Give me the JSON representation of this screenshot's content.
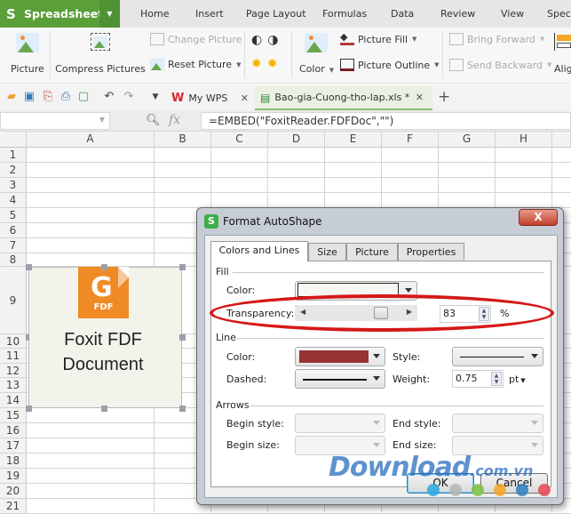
{
  "menubar": {
    "app_name": "Spreadsheets",
    "app_logo": "S",
    "items": [
      "Home",
      "Insert",
      "Page Layout",
      "Formulas",
      "Data",
      "Review",
      "View",
      "Spec"
    ]
  },
  "ribbon": {
    "picture": "Picture",
    "compress_pictures": "Compress Pictures",
    "change_picture": "Change Picture",
    "reset_picture": "Reset Picture",
    "color": "Color",
    "picture_fill": "Picture Fill",
    "picture_outline": "Picture Outline",
    "bring_forward": "Bring Forward",
    "send_backward": "Send Backward",
    "align": "Alig"
  },
  "tabs": [
    {
      "label": "My WPS",
      "icon": "wps-logo-icon"
    },
    {
      "label": "Bao-gia-Cuong-tho-lap.xls *",
      "icon": "xls-file-icon",
      "active": true
    }
  ],
  "formula_bar": {
    "name_box": "",
    "fx": "fx",
    "formula": "=EMBED(\"FoxitReader.FDFDoc\",\"\")"
  },
  "grid": {
    "columns": [
      "A",
      "B",
      "C",
      "D",
      "E",
      "F",
      "G",
      "H"
    ],
    "rows": [
      "1",
      "2",
      "3",
      "4",
      "5",
      "6",
      "7",
      "8",
      "9",
      "10",
      "11",
      "12",
      "13",
      "14",
      "15",
      "16",
      "17",
      "18",
      "19",
      "20",
      "21"
    ]
  },
  "embedded_object": {
    "icon_label": "FDF",
    "caption_line1": "Foxit FDF",
    "caption_line2": "Document",
    "accent": "#f08a24"
  },
  "dialog": {
    "title": "Format AutoShape",
    "close": "X",
    "tabs": [
      "Colors and Lines",
      "Size",
      "Picture",
      "Properties"
    ],
    "active_tab": "Colors and Lines",
    "fill": {
      "section": "Fill",
      "color_label": "Color:",
      "color_value": "#f7f7f2",
      "transparency_label": "Transparency:",
      "transparency_value": "83",
      "transparency_unit": "%",
      "transparency_fraction": 0.83
    },
    "line": {
      "section": "Line",
      "color_label": "Color:",
      "color_value": "#993333",
      "style_label": "Style:",
      "dashed_label": "Dashed:",
      "weight_label": "Weight:",
      "weight_value": "0.75",
      "weight_unit": "pt"
    },
    "arrows": {
      "section": "Arrows",
      "begin_style": "Begin style:",
      "end_style": "End style:",
      "begin_size": "Begin size:",
      "end_size": "End size:"
    },
    "ok": "OK",
    "cancel": "Cancel"
  },
  "watermark": {
    "main": "Download",
    "suffix": ".com.vn",
    "dot_colors": [
      "#29a8e0",
      "#b5b5b5",
      "#7cc242",
      "#f5a623",
      "#2d7fc1",
      "#e84855"
    ]
  },
  "highlight_color": "#d51818"
}
